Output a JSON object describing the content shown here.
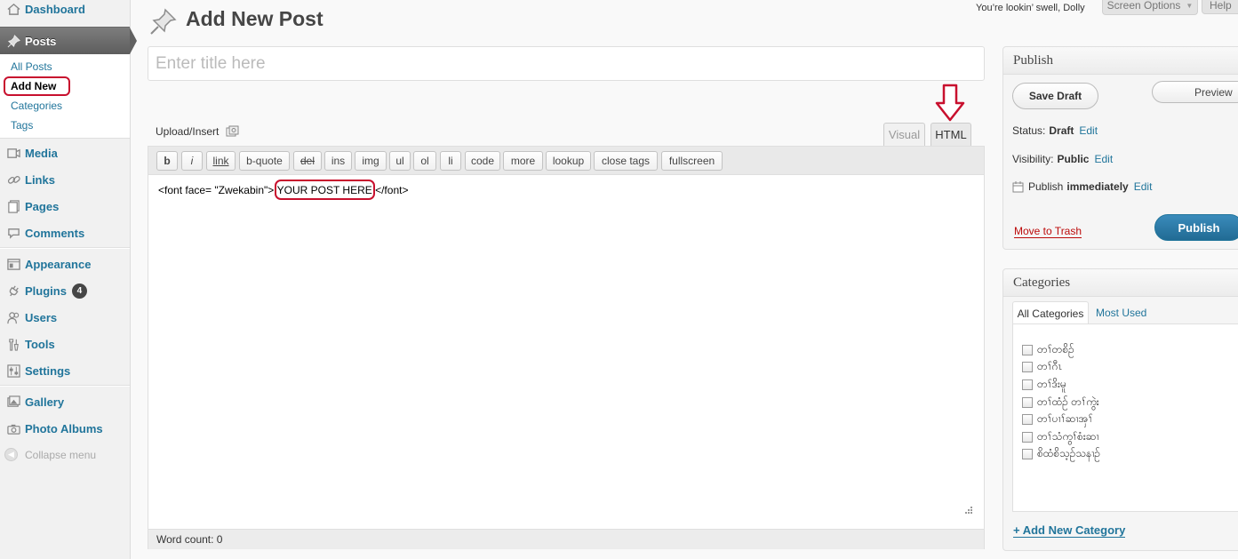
{
  "menu": {
    "dashboard": "Dashboard",
    "posts": "Posts",
    "posts_sub": [
      "All Posts",
      "Add New",
      "Categories",
      "Tags"
    ],
    "media": "Media",
    "links": "Links",
    "pages": "Pages",
    "comments": "Comments",
    "appearance": "Appearance",
    "plugins": "Plugins",
    "plugins_badge": "4",
    "users": "Users",
    "tools": "Tools",
    "settings": "Settings",
    "gallery": "Gallery",
    "photo_albums": "Photo Albums",
    "collapse": "Collapse menu"
  },
  "header": {
    "howdy": "You’re lookin’ swell, Dolly",
    "screen_options": "Screen Options",
    "help": "Help",
    "title": "Add New Post"
  },
  "editor": {
    "title_placeholder": "Enter title here",
    "upload_insert": "Upload/Insert",
    "tabs": {
      "visual": "Visual",
      "html": "HTML",
      "active": "html"
    },
    "quicktags": [
      "b",
      "i",
      "link",
      "b-quote",
      "del",
      "ins",
      "img",
      "ul",
      "ol",
      "li",
      "code",
      "more",
      "lookup",
      "close tags",
      "fullscreen"
    ],
    "content_before": "<font face= \"Zwekabin\">",
    "content_highlight": "YOUR POST HERE",
    "content_after": "</font>",
    "word_count": "Word count: 0"
  },
  "publish": {
    "heading": "Publish",
    "save_draft": "Save Draft",
    "preview": "Preview",
    "status_label": "Status:",
    "status_value": "Draft",
    "visibility_label": "Visibility:",
    "visibility_value": "Public",
    "publish_label": "Publish",
    "publish_value": "immediately",
    "edit": "Edit",
    "move_to_trash": "Move to Trash",
    "publish_button": "Publish"
  },
  "categories": {
    "heading": "Categories",
    "tab_all": "All Categories",
    "tab_most_used": "Most Used",
    "items": [
      "တၢ်တစိဉ်",
      "တၢ်ဂီၤ",
      "တၢ်ဒိးမူ",
      "တၢ်ထံဉ် တၢ်ကွဲး",
      "တၢ်ပၢၢ်ဆၢအှၢ်",
      "တၢ်သံကွၢ်စံးဆၢ",
      "စိထံစိသ့ဉ်သနၢဉ်"
    ],
    "add_new": "+ Add New Category"
  },
  "colors": {
    "link": "#21759b",
    "annotation_red": "#c8102e",
    "publish_blue": "#2a7aa8"
  }
}
